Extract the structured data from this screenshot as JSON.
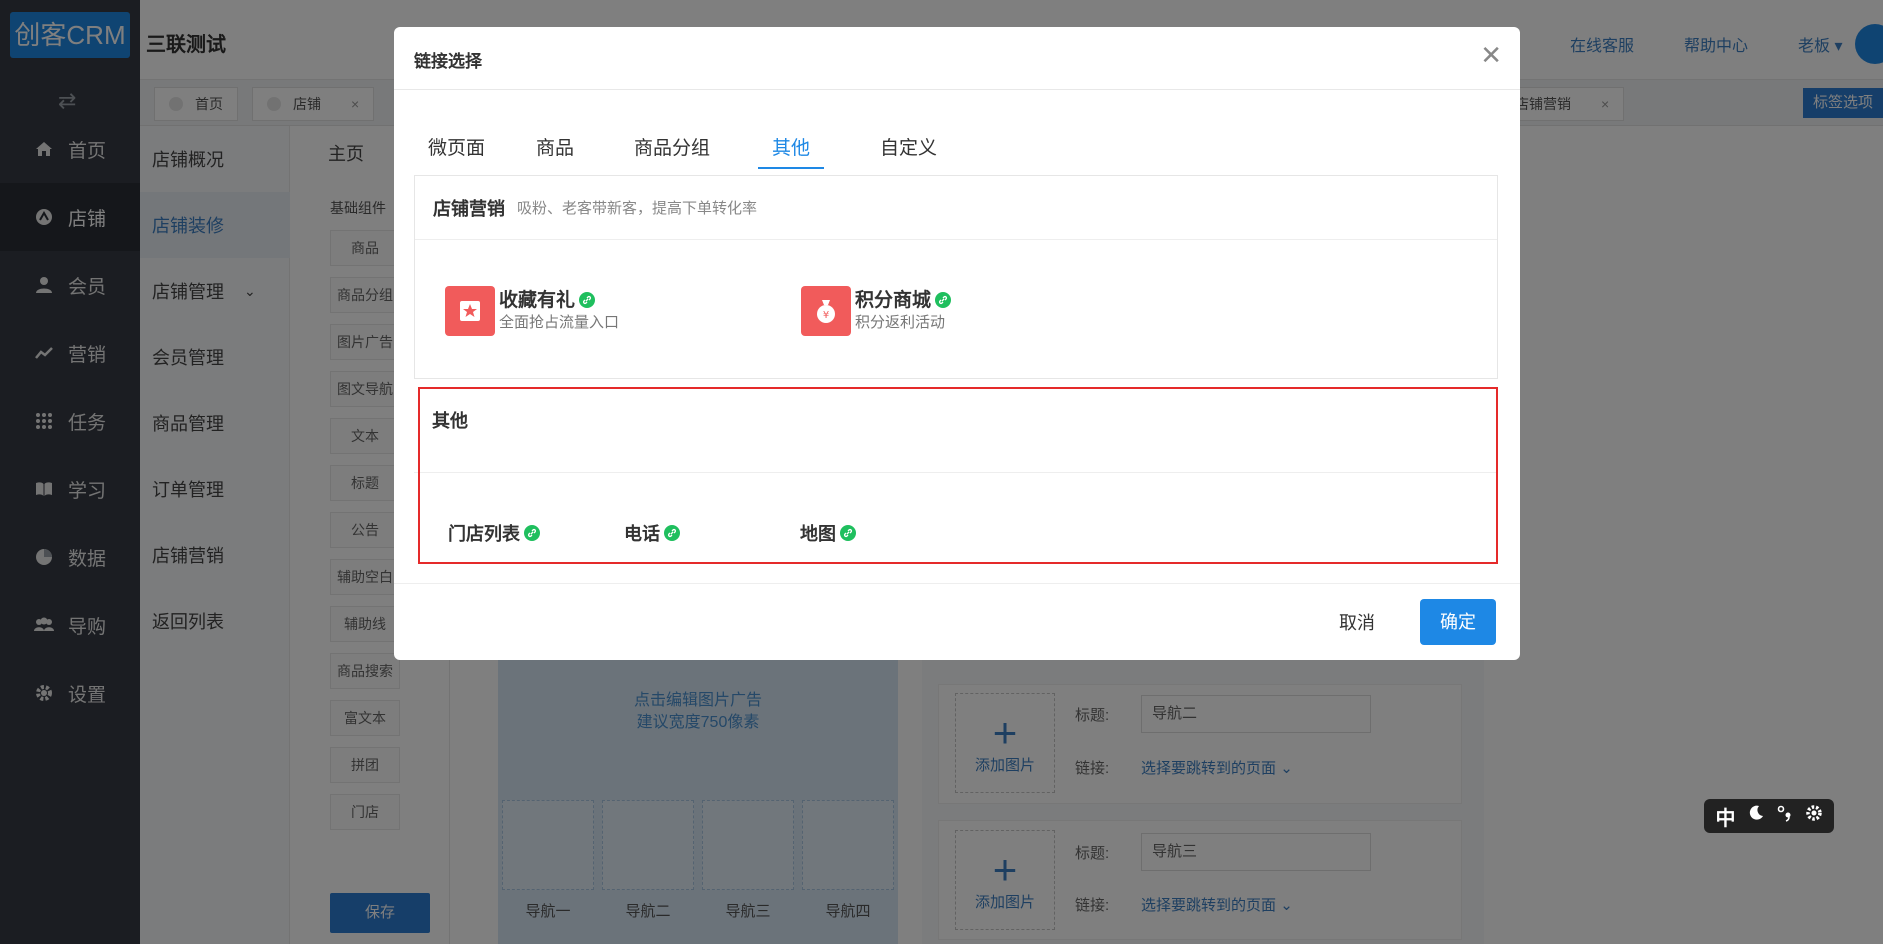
{
  "logo": "创客CRM",
  "sidebar": {
    "items": [
      {
        "label": "首页",
        "icon": "home-icon"
      },
      {
        "label": "店铺",
        "icon": "store-icon"
      },
      {
        "label": "会员",
        "icon": "user-icon"
      },
      {
        "label": "营销",
        "icon": "trend-icon"
      },
      {
        "label": "任务",
        "icon": "grid-icon"
      },
      {
        "label": "学习",
        "icon": "book-icon"
      },
      {
        "label": "数据",
        "icon": "pie-icon"
      },
      {
        "label": "导购",
        "icon": "group-icon"
      },
      {
        "label": "设置",
        "icon": "gear-icon"
      }
    ]
  },
  "header": {
    "shop_title": "三联测试",
    "online_service": "在线客服",
    "help_center": "帮助中心",
    "user": "老板"
  },
  "tabstrip": {
    "tabs": [
      "首页",
      "店铺",
      "店铺营销"
    ],
    "tag_option": "标签选项"
  },
  "submenu": {
    "items": [
      "店铺概况",
      "店铺装修",
      "店铺管理",
      "会员管理",
      "商品管理",
      "订单管理",
      "店铺营销",
      "返回列表"
    ]
  },
  "main": {
    "breadcrumb": "主页",
    "components_title": "基础组件",
    "components": [
      "商品",
      "商品分组",
      "图片广告",
      "图文导航",
      "文本",
      "标题",
      "公告",
      "辅助空白",
      "辅助线",
      "商品搜索",
      "富文本",
      "拼团",
      "门店"
    ],
    "save": "保存",
    "preview_ad_line1": "点击编辑图片广告",
    "preview_ad_line2": "建议宽度750像素",
    "nav_labels": [
      "导航一",
      "导航二",
      "导航三",
      "导航四"
    ],
    "editor": {
      "add_image": "添加图片",
      "title_label": "标题:",
      "link_label": "链接:",
      "link_placeholder": "选择要跳转到的页面",
      "nav2_value": "导航二",
      "nav3_value": "导航三"
    }
  },
  "modal": {
    "title": "链接选择",
    "tabs": [
      "微页面",
      "商品",
      "商品分组",
      "其他",
      "自定义"
    ],
    "active_tab": "其他",
    "marketing": {
      "title": "店铺营销",
      "subtitle": "吸粉、老客带新客，提高下单转化率",
      "apps": [
        {
          "name": "收藏有礼",
          "desc": "全面抢占流量入口"
        },
        {
          "name": "积分商城",
          "desc": "积分返利活动"
        }
      ]
    },
    "other": {
      "title": "其他",
      "items": [
        "门店列表",
        "电话",
        "地图"
      ]
    },
    "cancel": "取消",
    "confirm": "确定"
  },
  "ime": {
    "lang": "中"
  }
}
